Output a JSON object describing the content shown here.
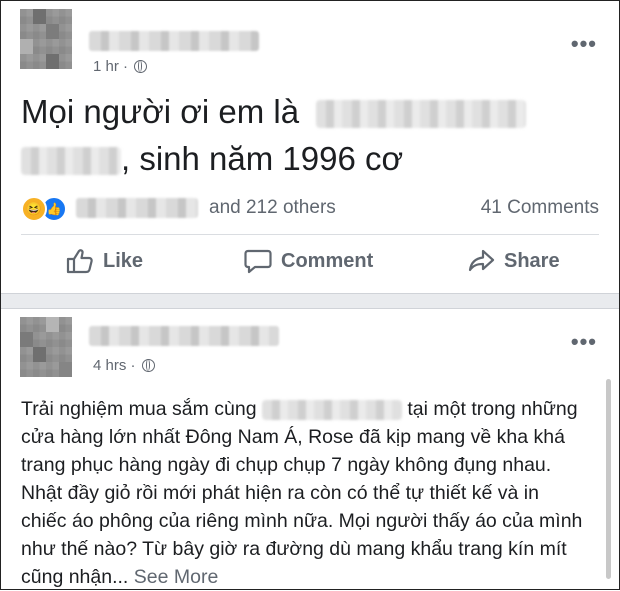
{
  "post1": {
    "time": "1 hr ·",
    "more_label": "•••",
    "text_line1": "Mọi người ơi em là",
    "text_line2_end": ", sinh năm 1996 cơ",
    "reactions": {
      "others": "and 212 others",
      "comments": "41 Comments",
      "icons": [
        "haha-emoji",
        "like-emoji"
      ]
    },
    "actions": {
      "like": "Like",
      "comment": "Comment",
      "share": "Share"
    }
  },
  "post2": {
    "time": "4 hrs ·",
    "more_label": "•••",
    "body_start": "Trải nghiệm mua sắm cùng ",
    "body_rest": " tại một trong những cửa hàng lớn nhất Đông Nam Á, Rose đã kịp mang về kha khá trang phục hàng ngày đi chụp chụp 7 ngày không đụng nhau. Nhật đầy giỏ rồi mới phát hiện ra còn có thể tự thiết kế và in chiếc áo phông của riêng mình nữa. Mọi người thấy áo của mình như thế nào? Từ bây giờ ra đường dù mang khẩu trang kín mít cũng nhận...",
    "see_more": " See More"
  },
  "colors": {
    "text": "#1c1e21",
    "muted": "#606770",
    "like_blue": "#1877f2",
    "haha_yellow": "#f7b125",
    "separator": "#e9ebee"
  }
}
